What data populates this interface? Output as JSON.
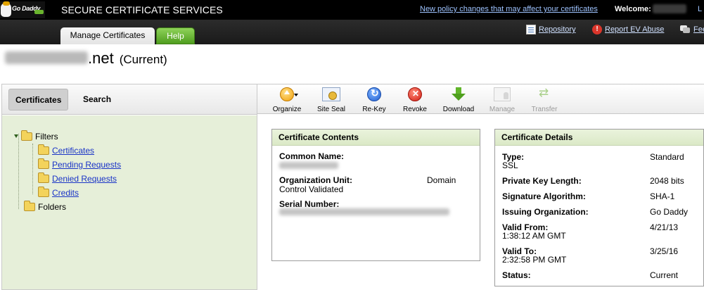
{
  "header": {
    "logo_text": "Go Daddy",
    "app_title": "SECURE CERTIFICATE SERVICES",
    "policy_link": "New policy changes that may affect your certificates",
    "welcome_label": "Welcome:",
    "right_clip": "L"
  },
  "tabs": {
    "manage": "Manage Certificates",
    "help": "Help"
  },
  "utility": {
    "repository": "Repository",
    "report_ev_abuse": "Report EV Abuse",
    "feedback_clip": "Fee"
  },
  "domain": {
    "tld": ".net",
    "status": "(Current)"
  },
  "left_panel": {
    "tabs": [
      "Certificates",
      "Search"
    ],
    "tree": {
      "filters": "Filters",
      "children": [
        "Certificates",
        "Pending Requests",
        "Denied Requests",
        "Credits"
      ],
      "folders": "Folders"
    }
  },
  "toolbar": {
    "items": [
      {
        "label": "Organize",
        "icon": "organize-icon",
        "enabled": true
      },
      {
        "label": "Site Seal",
        "icon": "site-seal-icon",
        "enabled": true
      },
      {
        "label": "Re-Key",
        "icon": "rekey-icon",
        "enabled": true
      },
      {
        "label": "Revoke",
        "icon": "revoke-icon",
        "enabled": true
      },
      {
        "label": "Download",
        "icon": "download-icon",
        "enabled": true
      },
      {
        "label": "Manage",
        "icon": "manage-icon",
        "enabled": false
      },
      {
        "label": "Transfer",
        "icon": "transfer-icon",
        "enabled": false
      }
    ]
  },
  "contents": {
    "title": "Certificate Contents",
    "common_name_label": "Common Name:",
    "org_unit_label": "Organization Unit:",
    "org_unit_value_1": "Domain",
    "org_unit_value_2": "Control Validated",
    "serial_label": "Serial Number:"
  },
  "details": {
    "title": "Certificate Details",
    "type_label": "Type:",
    "type_value_1": "Standard",
    "type_value_2": "SSL",
    "key_label": "Private Key Length:",
    "key_value": "2048 bits",
    "sig_label": "Signature Algorithm:",
    "sig_value": "SHA-1",
    "issuer_label": "Issuing Organization:",
    "issuer_value": "Go Daddy",
    "from_label": "Valid From:",
    "from_date": "4/21/13",
    "from_time": "1:38:12 AM GMT",
    "to_label": "Valid To:",
    "to_date": "3/25/16",
    "to_time": "2:32:58 PM GMT",
    "status_label": "Status:",
    "status_value": "Current"
  },
  "colors": {
    "header_bg": "#000000",
    "help_tab": "#5bab28",
    "tree_bg": "#e6efd9",
    "box_header": "#e1edcf",
    "link": "#1a34c7"
  }
}
